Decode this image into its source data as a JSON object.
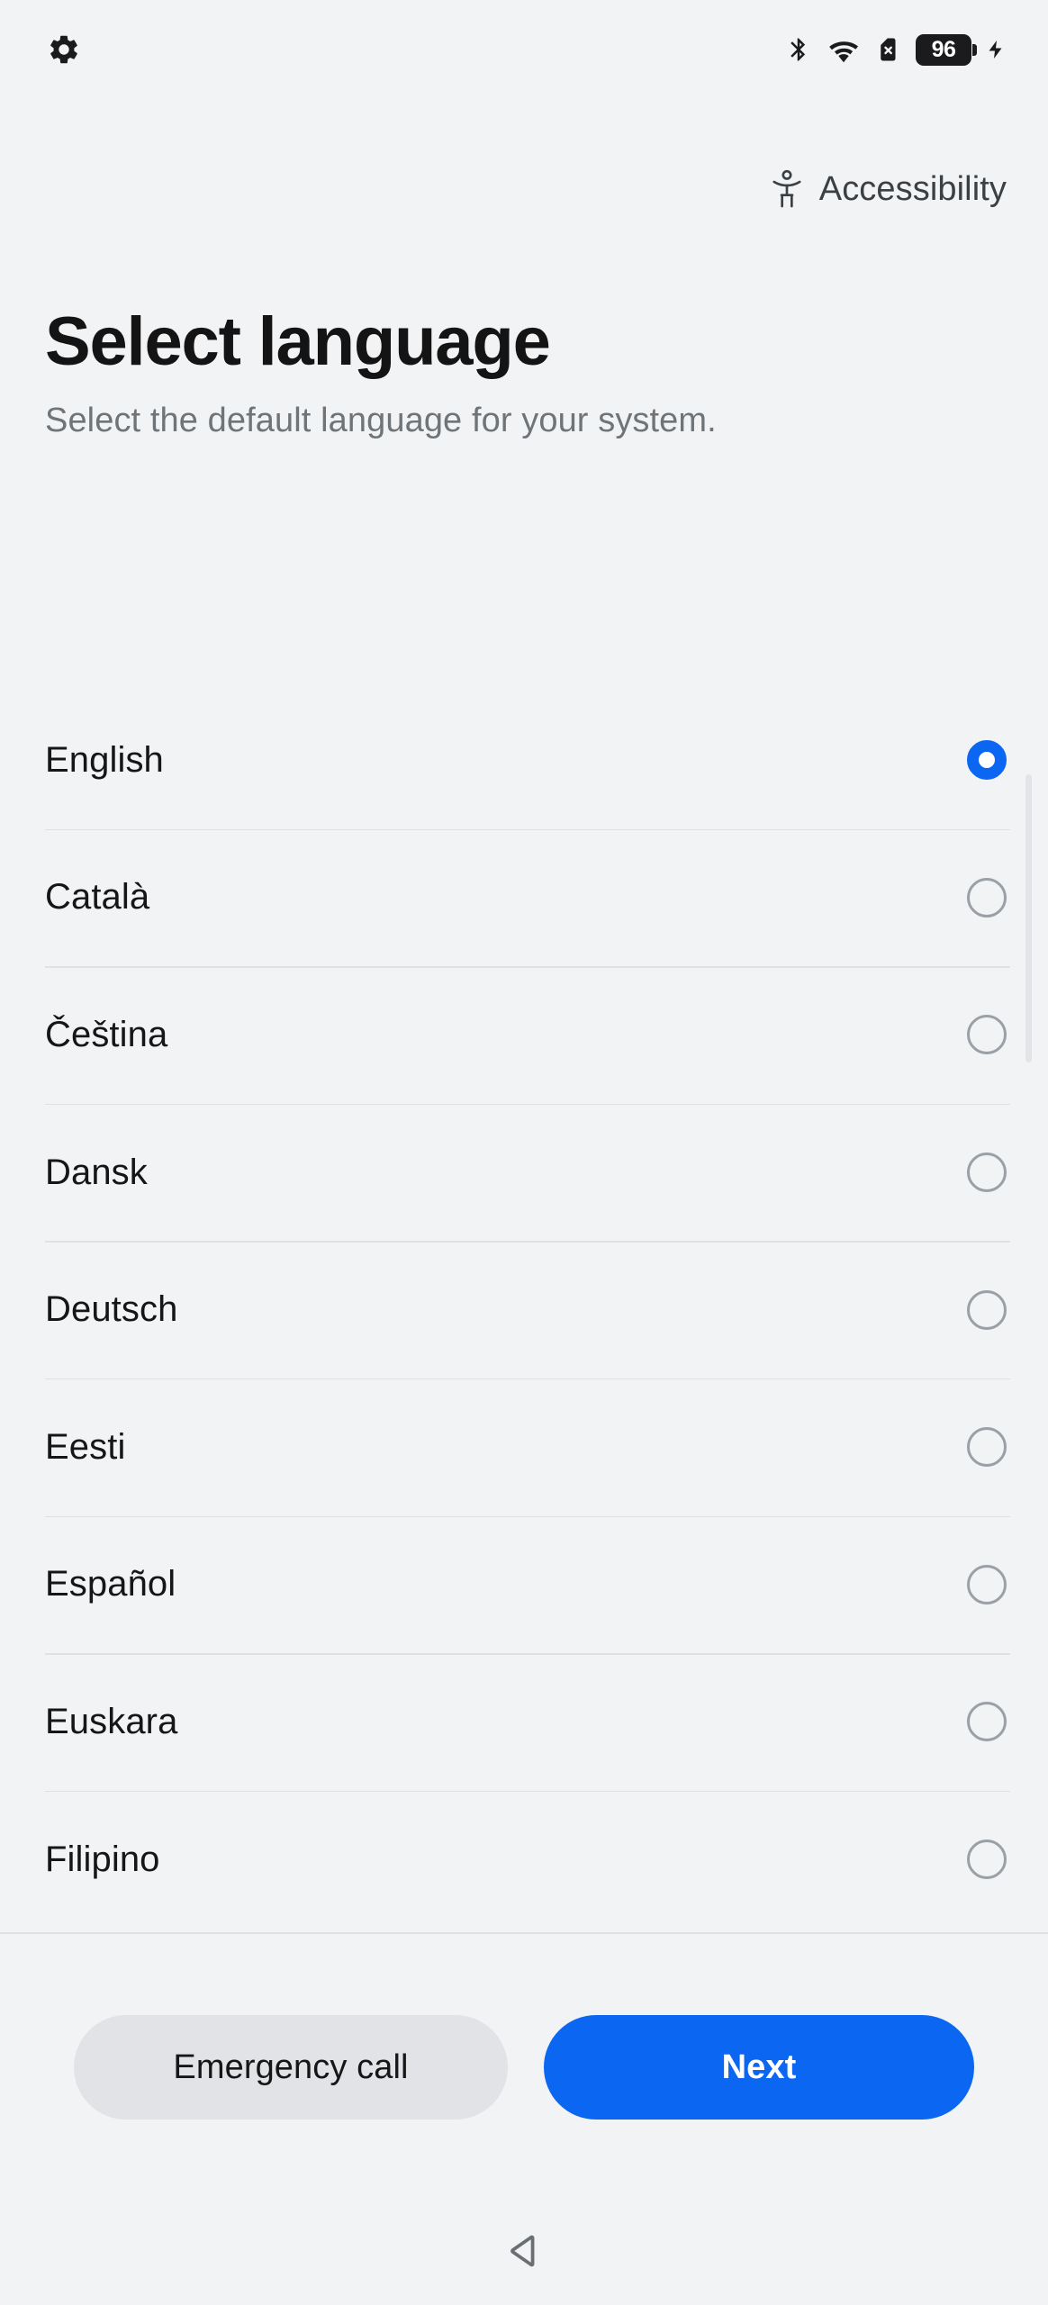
{
  "status_bar": {
    "settings_icon": "gear-icon",
    "icons": [
      {
        "name": "bluetooth-icon"
      },
      {
        "name": "wifi-icon"
      },
      {
        "name": "no-sim-icon"
      },
      {
        "name": "battery-icon"
      },
      {
        "name": "charging-bolt-icon"
      }
    ],
    "battery_level": "96"
  },
  "header": {
    "accessibility_label": "Accessibility",
    "accessibility_icon": "accessibility-person-icon"
  },
  "main": {
    "title": "Select language",
    "subtitle": "Select the default language for your system.",
    "languages": [
      {
        "label": "English",
        "selected": true
      },
      {
        "label": "Català",
        "selected": false
      },
      {
        "label": "Čeština",
        "selected": false
      },
      {
        "label": "Dansk",
        "selected": false
      },
      {
        "label": "Deutsch",
        "selected": false
      },
      {
        "label": "Eesti",
        "selected": false
      },
      {
        "label": "Español",
        "selected": false
      },
      {
        "label": "Euskara",
        "selected": false
      },
      {
        "label": "Filipino",
        "selected": false
      }
    ]
  },
  "actions": {
    "emergency_call_label": "Emergency call",
    "next_label": "Next"
  },
  "navigation": {
    "back_icon": "back-triangle-icon"
  },
  "colors": {
    "accent": "#0b67f2",
    "background": "#f1f3f5",
    "secondary_button": "#e2e3e6",
    "divider": "#dfe1e4",
    "radio_off": "#9aa0a6",
    "subtitle_text": "#6e7478"
  }
}
